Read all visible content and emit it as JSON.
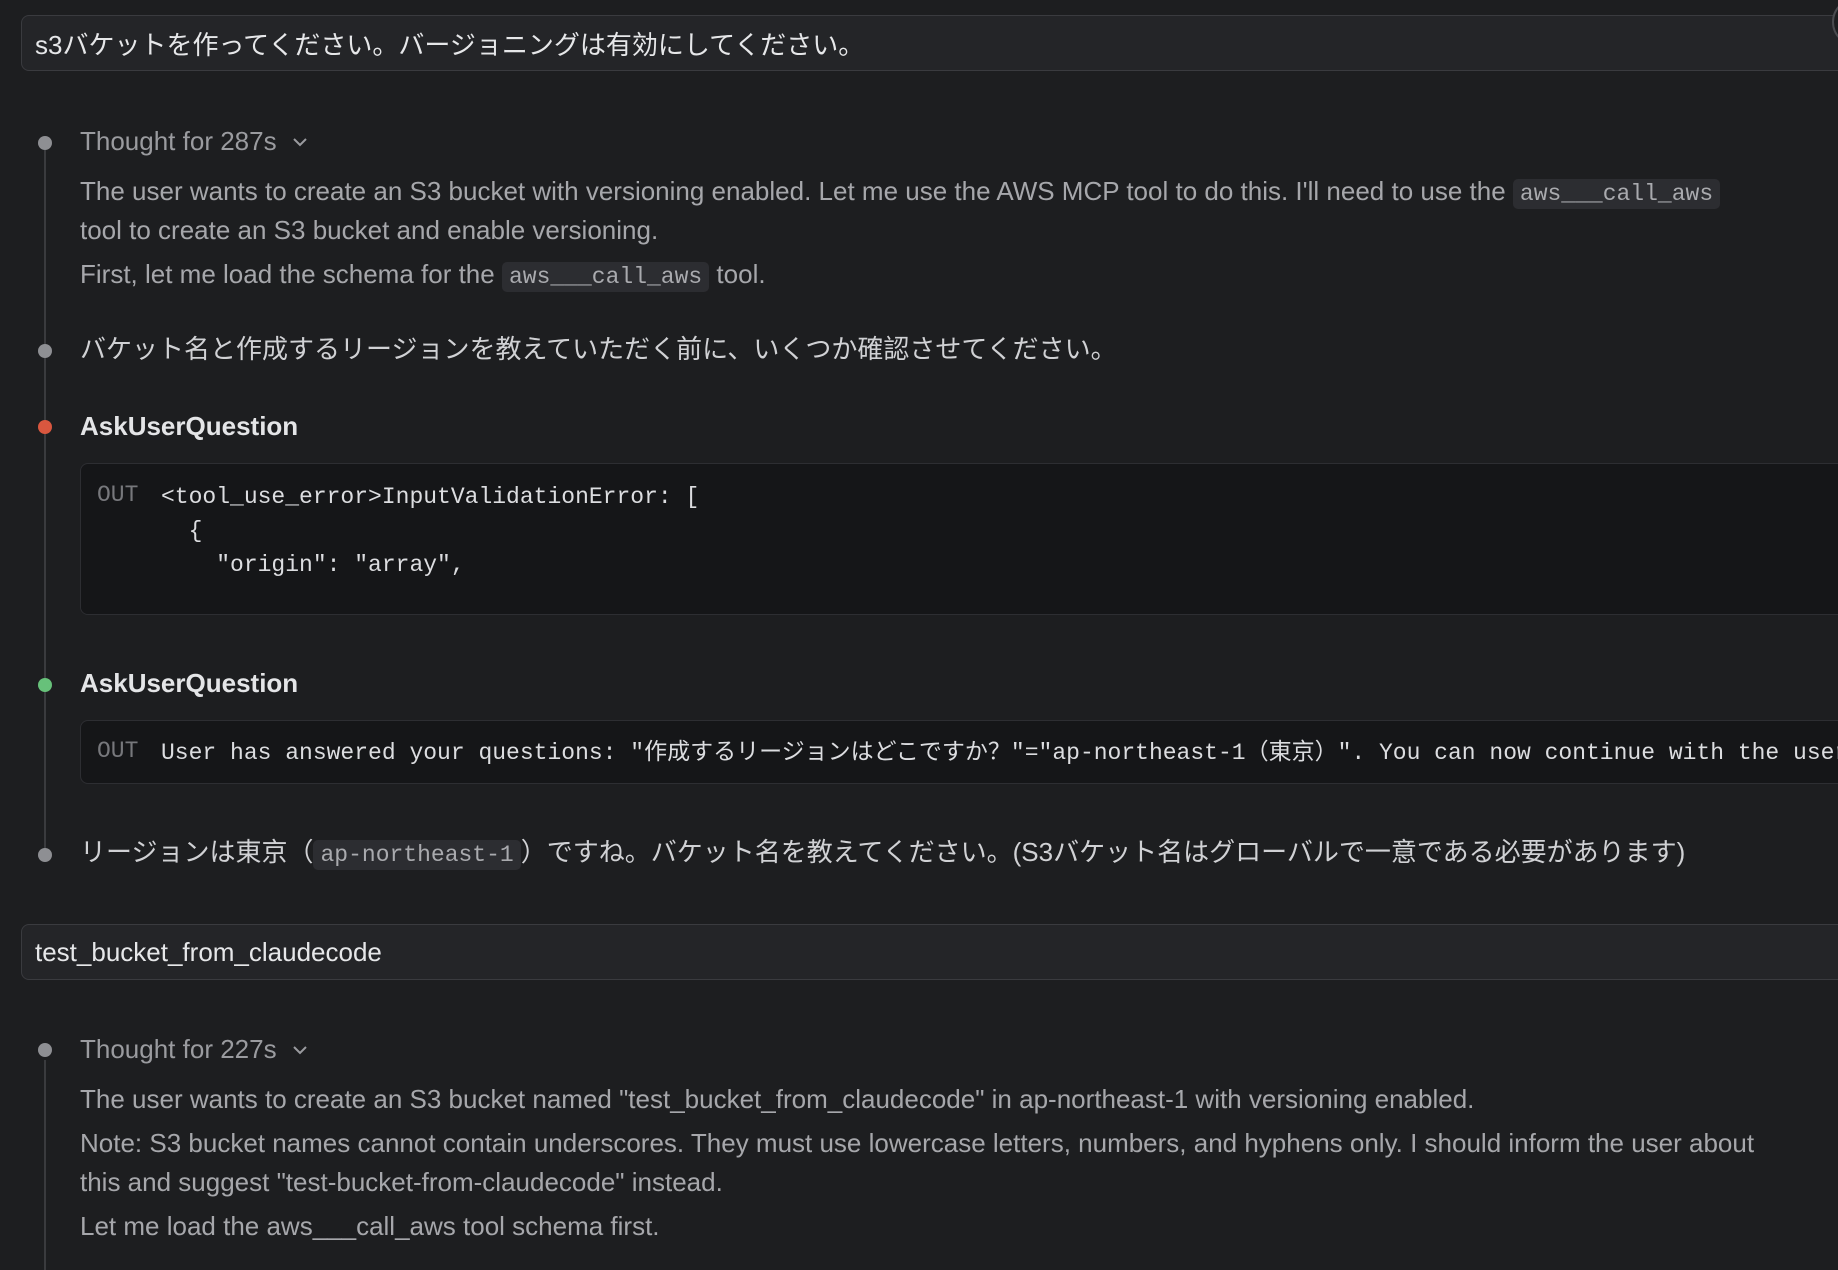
{
  "first_message": {
    "text": "s3バケットを作ってください。バージョニングは有効にしてください。"
  },
  "thought1": {
    "label": "Thought for 287s",
    "line1_pre": "The user wants to create an S3 bucket with versioning enabled. Let me use the AWS MCP tool to do this. I'll need to use the ",
    "line1_code": "aws___call_aws",
    "line2": "tool to create an S3 bucket and enable versioning.",
    "line3_pre": "First, let me load the schema for the ",
    "line3_code": "aws___call_aws",
    "line3_post": " tool."
  },
  "assistant_msg1": {
    "text": "バケット名と作成するリージョンを教えていただく前に、いくつか確認させてください。"
  },
  "tool1": {
    "title": "AskUserQuestion",
    "out_label": "OUT",
    "out_lines": [
      "<tool_use_error>InputValidationError: [",
      "  {",
      "    \"origin\": \"array\","
    ]
  },
  "tool2": {
    "title": "AskUserQuestion",
    "out_label": "OUT",
    "out_text": "User has answered your questions: \"作成するリージョンはどこですか？\"=\"ap-northeast-1（東京）\". You can now continue with the user's"
  },
  "assistant_msg2": {
    "pre": "リージョンは東京（",
    "code": "ap-northeast-1",
    "post": "）ですね。バケット名を教えてください。(S3バケット名はグローバルで一意である必要があります)"
  },
  "second_message": {
    "text": "test_bucket_from_claudecode"
  },
  "thought2": {
    "label": "Thought for 227s",
    "line1": "The user wants to create an S3 bucket named \"test_bucket_from_claudecode\" in ap-northeast-1 with versioning enabled.",
    "line2": "Note: S3 bucket names cannot contain underscores. They must use lowercase letters, numbers, and hyphens only. I should inform the user about",
    "line3": "this and suggest \"test-bucket-from-claudecode\" instead.",
    "line4": "Let me load the aws___call_aws tool schema first."
  },
  "colors": {
    "background": "#1d1e20",
    "error_dot": "#d9573f",
    "success_dot": "#67c17a",
    "neutral_dot": "#8e8f93"
  }
}
